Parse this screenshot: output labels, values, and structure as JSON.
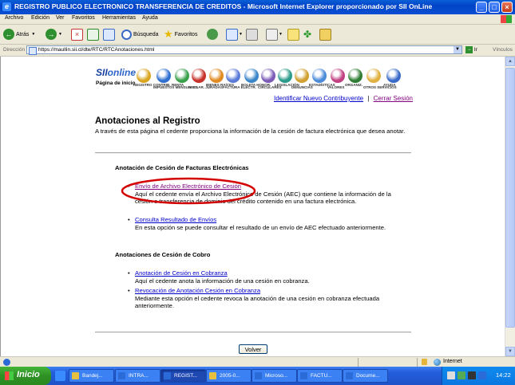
{
  "window": {
    "title": "REGISTRO PUBLICO ELECTRONICO TRANSFERENCIA DE CREDITOS - Microsoft Internet Explorer proporcionado por SII OnLine",
    "minimize": "_",
    "maximize": "□",
    "close": "×"
  },
  "menu": [
    "Archivo",
    "Edición",
    "Ver",
    "Favoritos",
    "Herramientas",
    "Ayuda"
  ],
  "toolbar": {
    "back": "Atrás",
    "search": "Búsqueda",
    "favorites": "Favoritos"
  },
  "address": {
    "label": "Dirección",
    "url": "https://maullin.sii.cl/dte/RTC/RTCAnotaciones.html",
    "go": "Ir",
    "links": "Vínculos"
  },
  "header": {
    "logo_text": "SII",
    "logo_text2": "online",
    "home_label": "Página de inicio",
    "nav_icons": [
      {
        "label": "REGISTRO CONTRIB.",
        "color": "#d9a520"
      },
      {
        "label": "IMPUESTOS MENSUALES",
        "color": "#2f6fd0"
      },
      {
        "label": "RENTA",
        "color": "#3aa04a"
      },
      {
        "label": "DECLAR. JURADAS",
        "color": "#c8302a"
      },
      {
        "label": "BIENES RAÍCES",
        "color": "#e08a20"
      },
      {
        "label": "FACTURA ELECTR.",
        "color": "#5a7ad8"
      },
      {
        "label": "BOLETA HONOR.",
        "color": "#3a85c8"
      },
      {
        "label": "CIRCULARES",
        "color": "#7b5ab8"
      },
      {
        "label": "LEGISLACIÓN",
        "color": "#2a9a8a"
      },
      {
        "label": "DENUNCIAS",
        "color": "#d0a030"
      },
      {
        "label": "ESTADÍSTICAS",
        "color": "#4a8ad8"
      },
      {
        "label": "VALORES",
        "color": "#c04080"
      },
      {
        "label": "ORGANIZ.",
        "color": "#2e7d32"
      },
      {
        "label": "OTROS SERVICIOS",
        "color": "#e0b040"
      },
      {
        "label": "AYUDA",
        "color": "#3a6ac8"
      }
    ],
    "identify_link": "Identificar Nuevo Contribuyente",
    "separator": "|",
    "logout_link": "Cerrar Sesión"
  },
  "main": {
    "title": "Anotaciones al Registro",
    "intro": "A través de esta página el cedente proporciona la información de la cesión de factura electrónica que desea anotar.",
    "section1": {
      "title": "Anotación de Cesión de Facturas Electrónicas",
      "items": [
        {
          "link": "Envío de Archivo Electrónico de Cesión",
          "desc": "Aquí el cedente envía el Archivo Electrónico de Cesión (AEC) que contiene la información de la cesión o transferencia de dominio del crédito contenido en una factura electrónica."
        },
        {
          "link": "Consulta Resultado de Envíos",
          "desc": "En esta opción se puede consultar el resultado de un envío de AEC efectuado anteriormente."
        }
      ]
    },
    "section2": {
      "title": "Anotaciones de Cesión de Cobro",
      "items": [
        {
          "link": "Anotación de Cesión en Cobranza",
          "desc": "Aquí el cedente anota la información de una cesión en cobranza."
        },
        {
          "link": "Revocación de Anotación Cesión en Cobranza",
          "desc": "Mediante esta opción el cedente revoca la anotación de una cesión en cobranza efectuada anteriormente."
        }
      ]
    },
    "back_button": "Volver",
    "bullet": "•",
    "annotation_color": "#d40000"
  },
  "status": {
    "zone": "Internet"
  },
  "taskbar": {
    "start": "Inicio",
    "tasks": [
      {
        "label": "Bandej...",
        "color": "#e8c040",
        "active": false
      },
      {
        "label": "INTRA...",
        "color": "#2a6bd8",
        "active": false
      },
      {
        "label": "REGIST...",
        "color": "#2a6bd8",
        "active": true
      },
      {
        "label": "2005-0...",
        "color": "#e8c040",
        "active": false
      },
      {
        "label": "Microso...",
        "color": "#2a6bd8",
        "active": false
      },
      {
        "label": "FACTU...",
        "color": "#2a6bd8",
        "active": false
      },
      {
        "label": "Docume...",
        "color": "#2a6bd8",
        "active": false
      }
    ],
    "clock": "14:22"
  }
}
